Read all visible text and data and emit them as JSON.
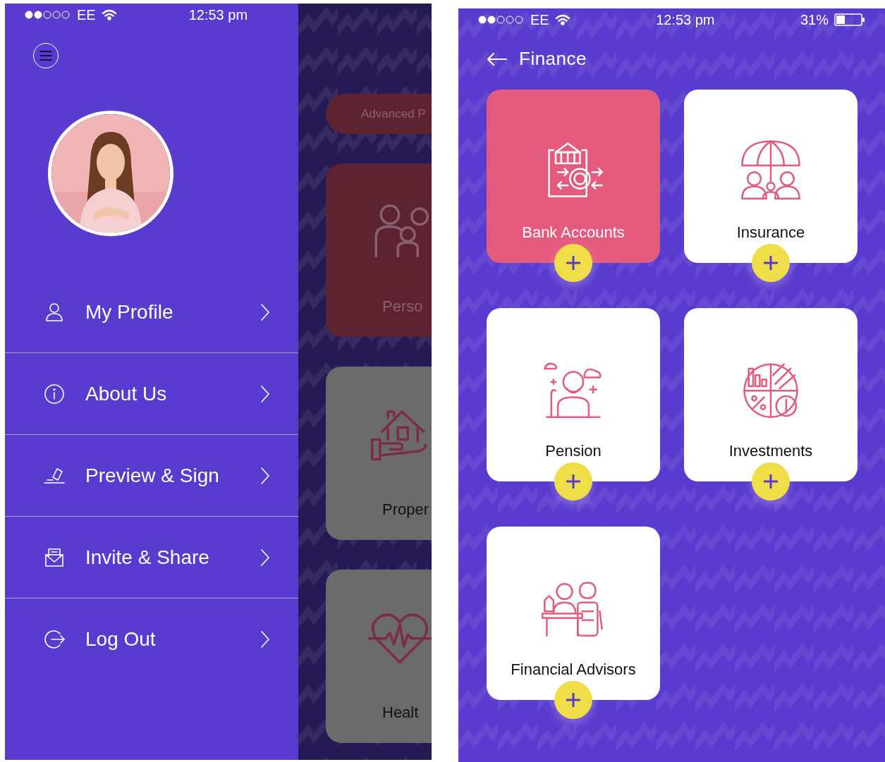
{
  "left_screen": {
    "status_bar": {
      "carrier": "EE",
      "time": "12:53 pm"
    },
    "menu": [
      {
        "label": "My Profile"
      },
      {
        "label": "About Us"
      },
      {
        "label": "Preview & Sign"
      },
      {
        "label": "Invite & Share"
      },
      {
        "label": "Log Out"
      }
    ],
    "dimmed_content": {
      "pill": "Advanced P",
      "cards": [
        {
          "label": "Perso",
          "selected": true
        },
        {
          "label": "Proper",
          "selected": false
        },
        {
          "label": "Healt",
          "selected": false
        }
      ]
    }
  },
  "right_screen": {
    "status_bar": {
      "carrier": "EE",
      "time": "12:53 pm",
      "battery": "31%"
    },
    "title": "Finance",
    "tiles": [
      {
        "label": "Bank Accounts",
        "selected": true
      },
      {
        "label": "Insurance",
        "selected": false
      },
      {
        "label": "Pension",
        "selected": false
      },
      {
        "label": "Investments",
        "selected": false
      },
      {
        "label": "Financial Advisors",
        "selected": false
      }
    ]
  }
}
